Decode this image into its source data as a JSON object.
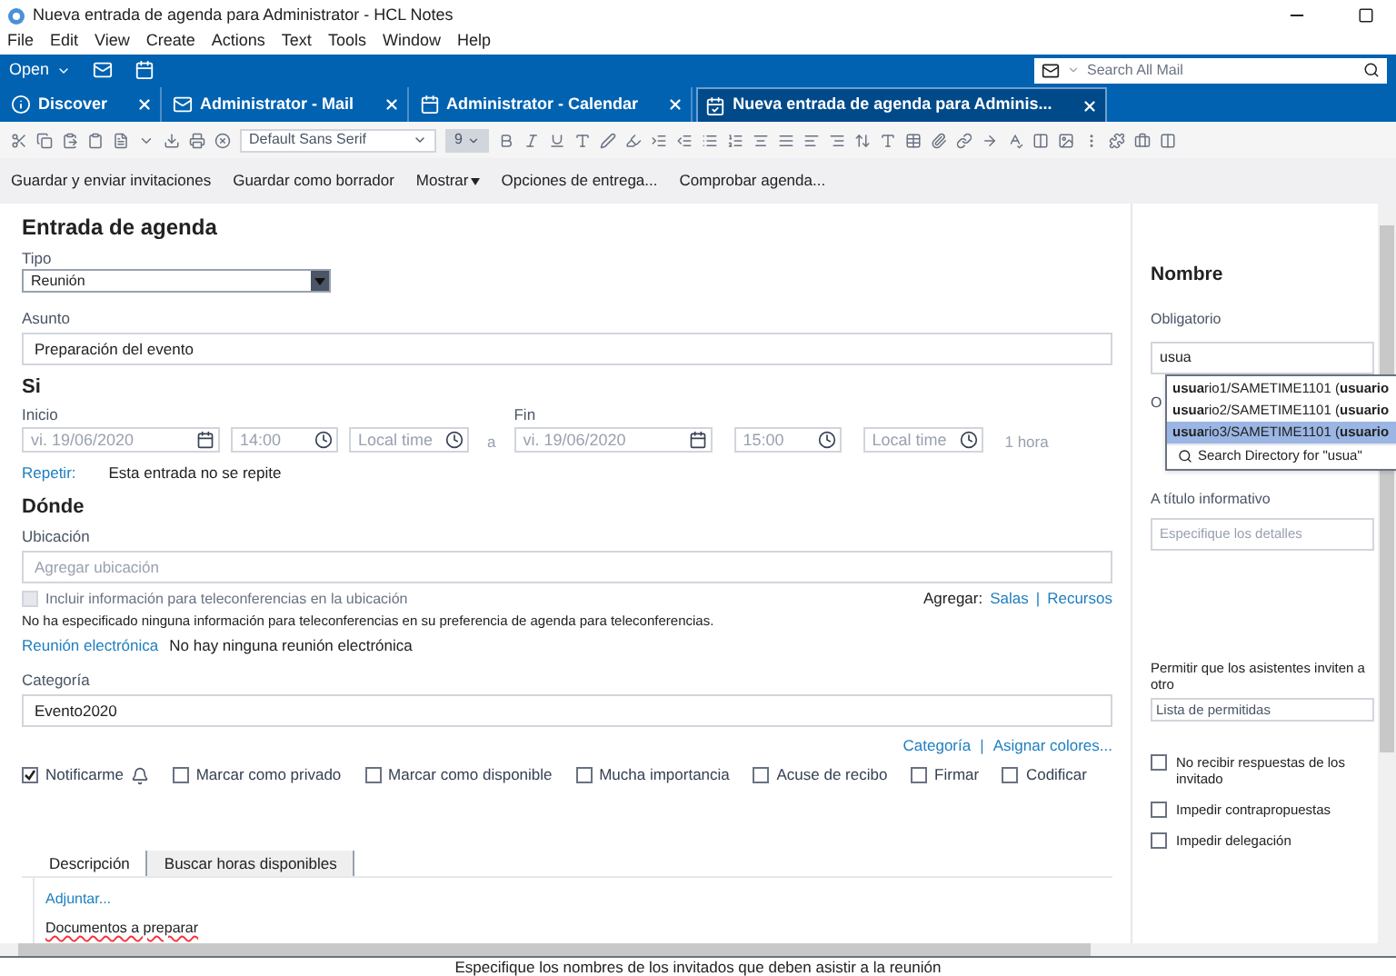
{
  "window": {
    "title": "Nueva entrada de agenda para Administrator - HCL Notes"
  },
  "menu": [
    "File",
    "Edit",
    "View",
    "Create",
    "Actions",
    "Text",
    "Tools",
    "Window",
    "Help"
  ],
  "toolbar": {
    "open": "Open",
    "search_placeholder": "Search All Mail"
  },
  "tabs": [
    {
      "label": "Discover",
      "kind": "info",
      "selected": false
    },
    {
      "label": "Administrator - Mail",
      "kind": "mail",
      "selected": false
    },
    {
      "label": "Administrator - Calendar",
      "kind": "calendar",
      "selected": false
    },
    {
      "label": "Nueva entrada de agenda para Adminis...",
      "kind": "entry",
      "selected": true
    }
  ],
  "format_bar": {
    "font": "Default Sans Serif",
    "size": "9"
  },
  "actions": [
    {
      "label": "Guardar y enviar invitaciones",
      "dropdown": false
    },
    {
      "label": "Guardar como borrador",
      "dropdown": false
    },
    {
      "label": "Mostrar",
      "dropdown": true
    },
    {
      "label": "Opciones de entrega...",
      "dropdown": false
    },
    {
      "label": "Comprobar agenda...",
      "dropdown": false
    }
  ],
  "form": {
    "heading": "Entrada de agenda",
    "type": {
      "label": "Tipo",
      "value": "Reunión"
    },
    "subject": {
      "label": "Asunto",
      "value": "Preparación del evento"
    },
    "when": {
      "heading": "Si",
      "start": {
        "label": "Inicio",
        "date": "vi. 19/06/2020",
        "time": "14:00",
        "zone": "Local time"
      },
      "separator": "a",
      "end": {
        "label": "Fin",
        "date": "vi. 19/06/2020",
        "time": "15:00",
        "zone": "Local time"
      },
      "duration": "1 hora",
      "repeat_link": "Repetir:",
      "repeat_text": "Esta entrada no se repite"
    },
    "where": {
      "heading": "Dónde",
      "label": "Ubicación",
      "placeholder": "Agregar ubicación",
      "teleconf": {
        "label": "Incluir información para teleconferencias en la ubicación",
        "checked": false,
        "disabled": true
      },
      "add_label": "Agregar:",
      "add_links": [
        "Salas",
        "Recursos"
      ],
      "link_separator": "|",
      "note": "No ha especificado ninguna información para teleconferencias en su preferencia de agenda para teleconferencias.",
      "online_link": "Reunión electrónica",
      "online_text": "No hay ninguna reunión electrónica"
    },
    "category": {
      "label": "Categoría",
      "value": "Evento2020",
      "links": [
        "Categoría",
        "Asignar colores..."
      ],
      "link_separator": "|"
    },
    "options": [
      {
        "label": "Notificarme",
        "checked": true,
        "bell": true
      },
      {
        "label": "Marcar como privado",
        "checked": false,
        "bell": false
      },
      {
        "label": "Marcar como disponible",
        "checked": false,
        "bell": false
      },
      {
        "label": "Mucha importancia",
        "checked": false,
        "bell": false
      },
      {
        "label": "Acuse de recibo",
        "checked": false,
        "bell": false
      },
      {
        "label": "Firmar",
        "checked": false,
        "bell": false
      },
      {
        "label": "Codificar",
        "checked": false,
        "bell": false
      }
    ],
    "body_tabs": [
      {
        "label": "Descripción",
        "selected": true
      },
      {
        "label": "Buscar horas disponibles",
        "selected": false
      }
    ],
    "attach_link": "Adjuntar...",
    "body_text": "Documentos a preparar"
  },
  "invitees": {
    "heading": "Nombre",
    "required_label": "Obligatorio",
    "required_value": "usua",
    "optional_label": "O",
    "suggestions": [
      {
        "text": "**usua**rio1/SAMETIME1101 (**usuario**",
        "selected": false
      },
      {
        "text": "**usua**rio2/SAMETIME1101 (**usuario**",
        "selected": false
      },
      {
        "text": "**usua**rio3/SAMETIME1101 (**usuario**",
        "selected": true
      }
    ],
    "search_directory": "Search Directory for \"usua\"",
    "fyi_label": "A título informativo",
    "fyi_placeholder": "Especifique los detalles",
    "allow_label": "Permitir que los asistentes inviten a otro",
    "allow_value": "Lista de permitidas",
    "checks": [
      {
        "label": "No recibir respuestas de los invitado",
        "checked": false
      },
      {
        "label": "Impedir contrapropuestas",
        "checked": false
      },
      {
        "label": "Impedir delegación",
        "checked": false
      }
    ]
  },
  "status_bar": "Especifique los nombres de los invitados que deben asistir a la reunión"
}
